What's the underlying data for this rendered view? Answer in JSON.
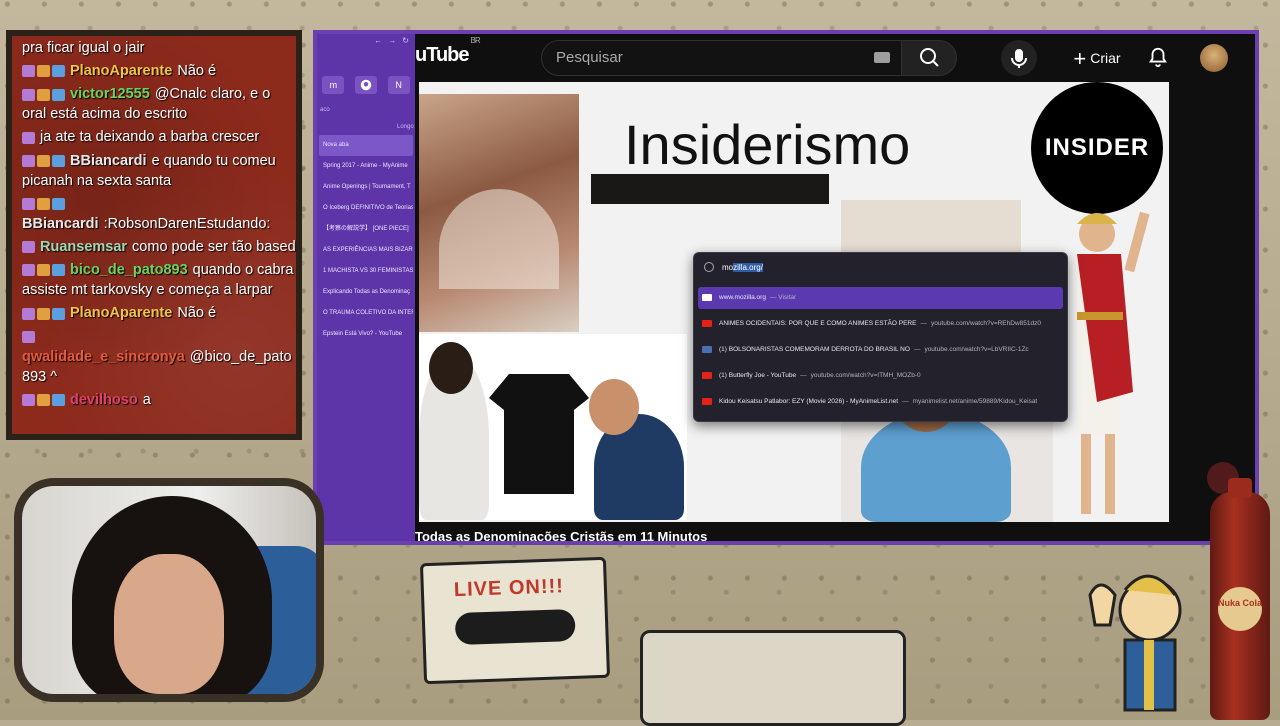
{
  "chat": {
    "messages": [
      {
        "user": "",
        "text": "pra ficar igual o jair",
        "color": "#ffffff"
      },
      {
        "user": "PlanoAparente",
        "text": "Não é",
        "color": "#f2c34a"
      },
      {
        "user": "victor12555",
        "text": "@Cnalc claro, e o oral está acima do escrito",
        "color": "#6ad35b"
      },
      {
        "user": "",
        "text": "ja ate ta deixando a barba crescer",
        "color": "#ff4040"
      },
      {
        "user": "BBiancardi",
        "text": "e quando tu comeu picanah na sexta santa",
        "color": "#e7e7e7"
      },
      {
        "user": "BBiancardi",
        "text": ":RobsonDarenEstudando:",
        "color": "#e7e7e7"
      },
      {
        "user": "Ruansemsar",
        "text": "como pode ser tão based",
        "color": "#9fd7b3"
      },
      {
        "user": "bico_de_pato893",
        "text": "quando o cabra assiste mt tarkovsky e começa a larpar",
        "color": "#6ad35b"
      },
      {
        "user": "PlanoAparente",
        "text": "Não é",
        "color": "#f2c34a"
      },
      {
        "user": "qwalidade_e_sincronya",
        "text": "@bico_de_pato893 ^",
        "color": "#e85a3c"
      },
      {
        "user": "devilhoso",
        "text": "a",
        "color": "#e0406a"
      }
    ]
  },
  "browser": {
    "sidebar": {
      "label_left": "aco",
      "label_right": "Longo",
      "icons": [
        "m",
        "github-icon",
        "N"
      ],
      "tabs": [
        "Nova aba",
        "Spring 2017 - Anime - MyAnime",
        "Anime Openings | Tournament, T",
        "O Iceberg DEFINITIVO de Teorias",
        "【考察の解説学】 [ONE PIECE]",
        "AS EXPERIÊNCIAS MAIS BIZARRA",
        "1 MACHISTA VS 30 FEMINISTAS",
        "Explicando Todas as Denominaç",
        "O TRAUMA COLETIVO DA INTER",
        "Epstein Está Vivo? - YouTube"
      ]
    },
    "youtube": {
      "logo": "uTube",
      "logo_region": "BR",
      "search_placeholder": "Pesquisar",
      "create_label": "Criar"
    },
    "video": {
      "slide_title": "Insiderismo",
      "insider_logo": "INSIDER",
      "below_title": "Todas as Denominações Cristãs em 11 Minutos"
    },
    "omnibox": {
      "typed": "mo",
      "autocomplete": "zilla.org/",
      "results": [
        {
          "title": "www.mozilla.org",
          "suffix": "— Visitar",
          "url": "",
          "icon": "mozilla-icon",
          "color": "#ffffff"
        },
        {
          "title": "ANIMES OCIDENTAIS: POR QUE E COMO ANIMES ESTÃO PERE",
          "suffix": "—",
          "url": "youtube.com/watch?v=REhDw851dz0",
          "icon": "youtube-icon",
          "color": "#e62117"
        },
        {
          "title": "(1) BOLSONARISTAS COMEMORAM DERROTA DO BRASIL NO",
          "suffix": "—",
          "url": "youtube.com/watch?v=LbVRIIC-1Zc",
          "icon": "page-icon",
          "color": "#4a6fb5"
        },
        {
          "title": "(1) Butterfly Joe - YouTube",
          "suffix": "—",
          "url": "youtube.com/watch?v=ITMH_MOZb-0",
          "icon": "youtube-icon",
          "color": "#e62117"
        },
        {
          "title": "Kidou Keisatsu Patlabor: EZY (Movie 2026) - MyAnimeList.net",
          "suffix": "—",
          "url": "myanimelist.net/anime/59889/Kidou_Keisat",
          "icon": "youtube-icon",
          "color": "#e62117"
        }
      ]
    }
  },
  "overlay": {
    "cassette_label": "LIVE ON!!!",
    "bottle_label": "Nuka Cola"
  }
}
